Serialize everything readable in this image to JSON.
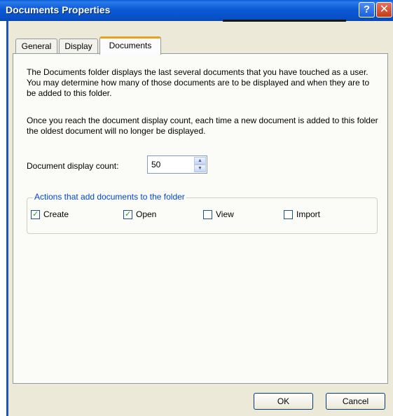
{
  "window": {
    "title": "Documents Properties"
  },
  "titlebar": {
    "help_glyph": "?",
    "close_glyph": "✕"
  },
  "tabs": [
    {
      "label": "General"
    },
    {
      "label": "Display"
    },
    {
      "label": "Documents"
    }
  ],
  "content": {
    "paragraph1": "The Documents folder displays the last several documents that you have touched as a user.  You may determine how many of those documents are to be displayed and when they are to be added to this folder.",
    "paragraph2": "Once you reach the document display count, each time a new document is added to this folder the oldest document will no longer be displayed."
  },
  "display_count": {
    "label": "Document display count:",
    "value": "50"
  },
  "actions_group": {
    "legend": "Actions that add documents to the folder",
    "options": [
      {
        "label": "Create",
        "checked": true,
        "check_glyph": "✓"
      },
      {
        "label": "Open",
        "checked": true,
        "check_glyph": "✓"
      },
      {
        "label": "View",
        "checked": false,
        "check_glyph": ""
      },
      {
        "label": "Import",
        "checked": false,
        "check_glyph": ""
      }
    ]
  },
  "buttons": {
    "ok_label": "OK",
    "cancel_label": "Cancel"
  },
  "colors": {
    "accent": "#0046d5",
    "titlebar": "#0b5ad5",
    "check": "#21a121"
  },
  "icons": {
    "help": "help-icon",
    "close": "close-icon",
    "spin_up": "spin-up-icon",
    "spin_down": "spin-down-icon"
  }
}
